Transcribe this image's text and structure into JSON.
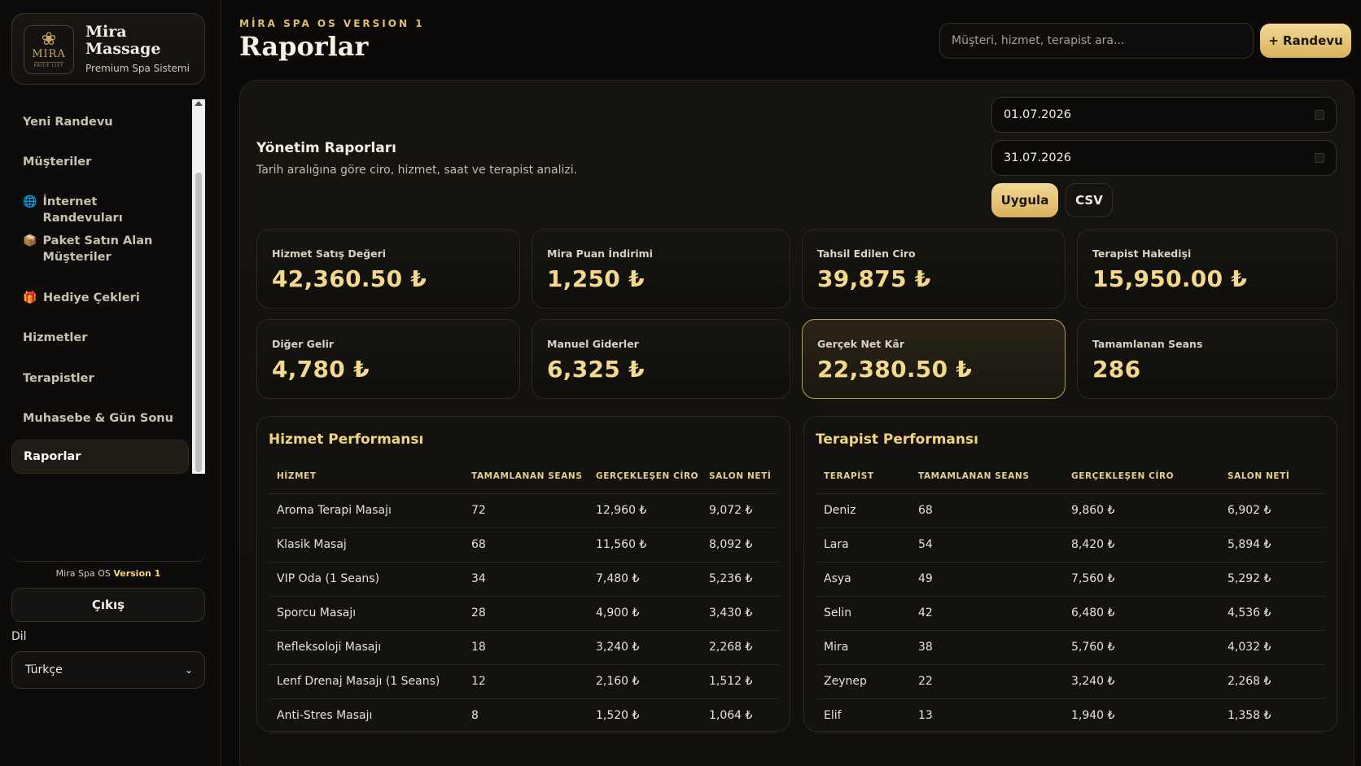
{
  "brand": {
    "logo_text": "MIRA",
    "logo_sub": "PRICE LIST",
    "name": "Mira Massage",
    "subtitle": "Premium Spa Sistemi"
  },
  "sidebar": {
    "items": [
      {
        "label": "Yeni Randevu",
        "icon": ""
      },
      {
        "label": "Müşteriler",
        "icon": ""
      },
      {
        "label": "İnternet Randevuları",
        "icon": "🌐"
      },
      {
        "label": "Paket Satın Alan Müşteriler",
        "icon": "📦"
      },
      {
        "label": "Hediye Çekleri",
        "icon": "🎁"
      },
      {
        "label": "Hizmetler",
        "icon": ""
      },
      {
        "label": "Terapistler",
        "icon": ""
      },
      {
        "label": "Muhasebe & Gün Sonu",
        "icon": ""
      },
      {
        "label": "Raporlar",
        "icon": "",
        "active": true
      }
    ],
    "version_prefix": "Mira Spa OS",
    "version_label": "Version 1",
    "logout_label": "Çıkış",
    "language_label": "Dil",
    "language_value": "Türkçe"
  },
  "header": {
    "kicker": "MİRA SPA OS VERSION 1",
    "title": "Raporlar",
    "search_placeholder": "Müşteri, hizmet, terapist ara...",
    "new_button": "+ Randevu"
  },
  "report": {
    "title": "Yönetim Raporları",
    "subtitle": "Tarih aralığına göre ciro, hizmet, saat ve terapist analizi.",
    "date_from": "01.07.2026",
    "date_to": "31.07.2026",
    "apply_label": "Uygula",
    "csv_label": "CSV"
  },
  "cards": [
    {
      "label": "Hizmet Satış Değeri",
      "value": "42,360.50 ₺"
    },
    {
      "label": "Mira Puan İndirimi",
      "value": "1,250 ₺"
    },
    {
      "label": "Tahsil Edilen Ciro",
      "value": "39,875 ₺"
    },
    {
      "label": "Terapist Hakedişi",
      "value": "15,950.00 ₺"
    },
    {
      "label": "Diğer Gelir",
      "value": "4,780 ₺"
    },
    {
      "label": "Manuel Giderler",
      "value": "6,325 ₺"
    },
    {
      "label": "Gerçek Net Kâr",
      "value": "22,380.50 ₺",
      "highlight": true
    },
    {
      "label": "Tamamlanan Seans",
      "value": "286"
    }
  ],
  "service_table": {
    "title": "Hizmet Performansı",
    "headers": [
      "HİZMET",
      "TAMAMLANAN SEANS",
      "GERÇEKLEŞEN CİRO",
      "SALON NETİ"
    ],
    "rows": [
      [
        "Aroma Terapi Masajı",
        "72",
        "12,960 ₺",
        "9,072 ₺"
      ],
      [
        "Klasik Masaj",
        "68",
        "11,560 ₺",
        "8,092 ₺"
      ],
      [
        "VIP Oda (1 Seans)",
        "34",
        "7,480 ₺",
        "5,236 ₺"
      ],
      [
        "Sporcu Masajı",
        "28",
        "4,900 ₺",
        "3,430 ₺"
      ],
      [
        "Refleksoloji Masajı",
        "18",
        "3,240 ₺",
        "2,268 ₺"
      ],
      [
        "Lenf Drenaj Masajı (1 Seans)",
        "12",
        "2,160 ₺",
        "1,512 ₺"
      ],
      [
        "Anti-Stres Masajı",
        "8",
        "1,520 ₺",
        "1,064 ₺"
      ]
    ]
  },
  "therapist_table": {
    "title": "Terapist Performansı",
    "headers": [
      "TERAPİST",
      "TAMAMLANAN SEANS",
      "GERÇEKLEŞEN CİRO",
      "SALON NETİ"
    ],
    "rows": [
      [
        "Deniz",
        "68",
        "9,860 ₺",
        "6,902 ₺"
      ],
      [
        "Lara",
        "54",
        "8,420 ₺",
        "5,894 ₺"
      ],
      [
        "Asya",
        "49",
        "7,560 ₺",
        "5,292 ₺"
      ],
      [
        "Selin",
        "42",
        "6,480 ₺",
        "4,536 ₺"
      ],
      [
        "Mira",
        "38",
        "5,760 ₺",
        "4,032 ₺"
      ],
      [
        "Zeynep",
        "22",
        "3,240 ₺",
        "2,268 ₺"
      ],
      [
        "Elif",
        "13",
        "1,940 ₺",
        "1,358 ₺"
      ]
    ]
  },
  "colors": {
    "accent_gold": "#e0c06a",
    "value_gold": "#f2d98c",
    "background": "#0b0a08"
  }
}
